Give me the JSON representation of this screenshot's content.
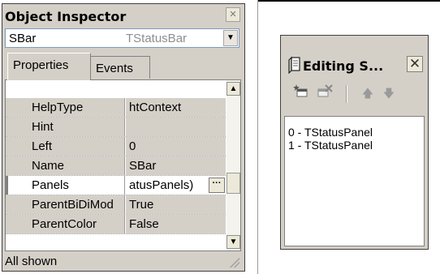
{
  "object_inspector": {
    "title": "Object Inspector",
    "selected_component": {
      "name": "SBar",
      "type": "TStatusBar"
    },
    "tabs": [
      {
        "label": "Properties",
        "active": true
      },
      {
        "label": "Events",
        "active": false
      }
    ],
    "properties": [
      {
        "name": "HelpType",
        "value": "htContext"
      },
      {
        "name": "Hint",
        "value": ""
      },
      {
        "name": "Left",
        "value": "0"
      },
      {
        "name": "Name",
        "value": "SBar"
      },
      {
        "name": "Panels",
        "value": "atusPanels)",
        "selected": true
      },
      {
        "name": "ParentBiDiMod",
        "value": "True"
      },
      {
        "name": "ParentColor",
        "value": "False"
      }
    ],
    "status_text": "All shown",
    "icons": {
      "close": "close-icon",
      "dropdown": "chevron-down-icon",
      "ellipsis": "ellipsis-icon",
      "scroll_up": "scroll-up-arrow-icon",
      "scroll_down": "scroll-down-arrow-icon",
      "grip": "resize-grip-icon"
    }
  },
  "editing_dialog": {
    "title": "Editing S...",
    "toolbar": {
      "add": "add-new-icon",
      "delete": "delete-icon",
      "move_up": "arrow-up-icon",
      "move_down": "arrow-down-icon"
    },
    "items": [
      "0 - TStatusPanel",
      "1 - TStatusPanel"
    ],
    "icons": {
      "title": "window-app-icon",
      "close": "close-icon"
    }
  },
  "colors": {
    "window_face": "#d4d0c8",
    "list_background": "#ffffff",
    "border": "#404040"
  }
}
